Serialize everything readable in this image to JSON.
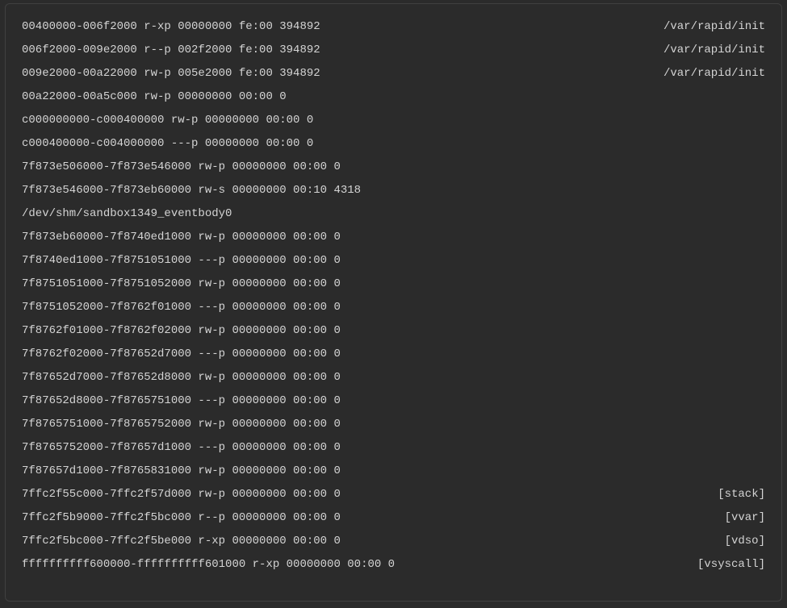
{
  "maps": [
    {
      "left": "00400000-006f2000 r-xp 00000000 fe:00 394892",
      "right": "/var/rapid/init"
    },
    {
      "left": "006f2000-009e2000 r--p 002f2000 fe:00 394892",
      "right": "/var/rapid/init"
    },
    {
      "left": "009e2000-00a22000 rw-p 005e2000 fe:00 394892",
      "right": "/var/rapid/init"
    },
    {
      "left": "00a22000-00a5c000 rw-p 00000000 00:00 0",
      "right": ""
    },
    {
      "left": "c000000000-c000400000 rw-p 00000000 00:00 0",
      "right": ""
    },
    {
      "left": "c000400000-c004000000 ---p 00000000 00:00 0",
      "right": ""
    },
    {
      "left": "7f873e506000-7f873e546000 rw-p 00000000 00:00 0",
      "right": ""
    },
    {
      "left": "7f873e546000-7f873eb60000 rw-s 00000000 00:10 4318",
      "right": "",
      "wrap": "/dev/shm/sandbox1349_eventbody0"
    },
    {
      "left": "7f873eb60000-7f8740ed1000 rw-p 00000000 00:00 0",
      "right": ""
    },
    {
      "left": "7f8740ed1000-7f8751051000 ---p 00000000 00:00 0",
      "right": ""
    },
    {
      "left": "7f8751051000-7f8751052000 rw-p 00000000 00:00 0",
      "right": ""
    },
    {
      "left": "7f8751052000-7f8762f01000 ---p 00000000 00:00 0",
      "right": ""
    },
    {
      "left": "7f8762f01000-7f8762f02000 rw-p 00000000 00:00 0",
      "right": ""
    },
    {
      "left": "7f8762f02000-7f87652d7000 ---p 00000000 00:00 0",
      "right": ""
    },
    {
      "left": "7f87652d7000-7f87652d8000 rw-p 00000000 00:00 0",
      "right": ""
    },
    {
      "left": "7f87652d8000-7f8765751000 ---p 00000000 00:00 0",
      "right": ""
    },
    {
      "left": "7f8765751000-7f8765752000 rw-p 00000000 00:00 0",
      "right": ""
    },
    {
      "left": "7f8765752000-7f87657d1000 ---p 00000000 00:00 0",
      "right": ""
    },
    {
      "left": "7f87657d1000-7f8765831000 rw-p 00000000 00:00 0",
      "right": ""
    },
    {
      "left": "7ffc2f55c000-7ffc2f57d000 rw-p 00000000 00:00 0",
      "right": "[stack]"
    },
    {
      "left": "7ffc2f5b9000-7ffc2f5bc000 r--p 00000000 00:00 0",
      "right": "[vvar]"
    },
    {
      "left": "7ffc2f5bc000-7ffc2f5be000 r-xp 00000000 00:00 0",
      "right": "[vdso]"
    },
    {
      "left": "ffffffffff600000-ffffffffff601000 r-xp 00000000 00:00 0",
      "right": "[vsyscall]"
    }
  ]
}
